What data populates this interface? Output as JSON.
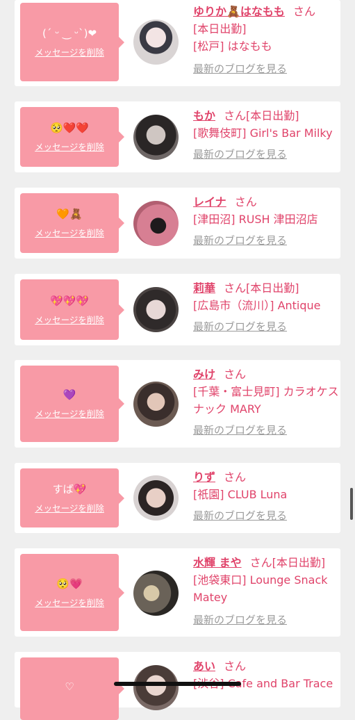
{
  "common": {
    "delete_label": "メッセージを削除",
    "blog_label": "最新のブログを見る",
    "san": "さん"
  },
  "cards": [
    {
      "message": "(´ ᵕ ‿ ᵕ`)❤",
      "name": "ゆりか🧸はなもも",
      "lines": [
        "[本日出勤]",
        "[松戸] はなもも"
      ]
    },
    {
      "message": "🥺❤️❤️",
      "name": "もか",
      "lines": [
        "[本日出勤]",
        "[歌舞伎町] Girl's Bar Milky"
      ]
    },
    {
      "message": "🧡🧸",
      "name": "レイナ",
      "lines": [
        "[津田沼] RUSH 津田沼店"
      ]
    },
    {
      "message": "💖💖💖",
      "name": "莉華",
      "lines": [
        "[本日出勤]",
        "[広島市（流川）] Antique"
      ]
    },
    {
      "message": "💜",
      "name": "みけ",
      "lines": [
        "[千葉・富士見町] カラオケスナック MARY"
      ]
    },
    {
      "message": "すば💖",
      "name": "りず",
      "lines": [
        "[祇園] CLUB Luna"
      ]
    },
    {
      "message": "🥺💗",
      "name": "水輝 まや",
      "lines": [
        "[本日出勤]",
        "[池袋東口] Lounge Snack Matey"
      ]
    },
    {
      "message": "♡",
      "name": "あい",
      "lines": [
        "[渋谷] Cafe and Bar Trace"
      ]
    }
  ],
  "colors": {
    "accent": "#e0436a",
    "bubble": "#f89aa6",
    "link_gray": "#9b9b9b"
  }
}
